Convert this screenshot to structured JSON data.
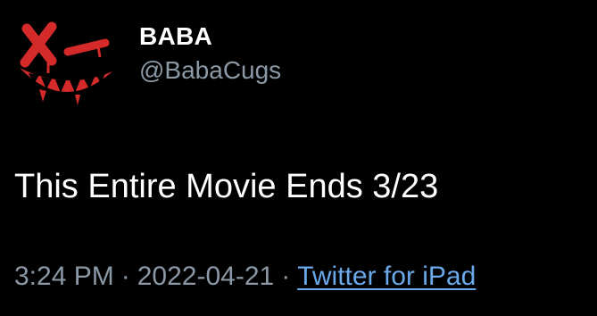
{
  "author": {
    "display_name": "BABA",
    "handle": "@BabaCugs",
    "avatar_icon": "red-x-eye-fanged-grin-icon"
  },
  "tweet": {
    "text": "This Entire Movie Ends 3/23"
  },
  "meta": {
    "time": "3:24 PM",
    "separator": "·",
    "date": "2022-04-21",
    "source": "Twitter for iPad"
  },
  "colors": {
    "background": "#000000",
    "primary_text": "#ffffff",
    "secondary_text": "#8b98a5",
    "link": "#6aa9e9",
    "avatar_red": "#d42a2a"
  }
}
